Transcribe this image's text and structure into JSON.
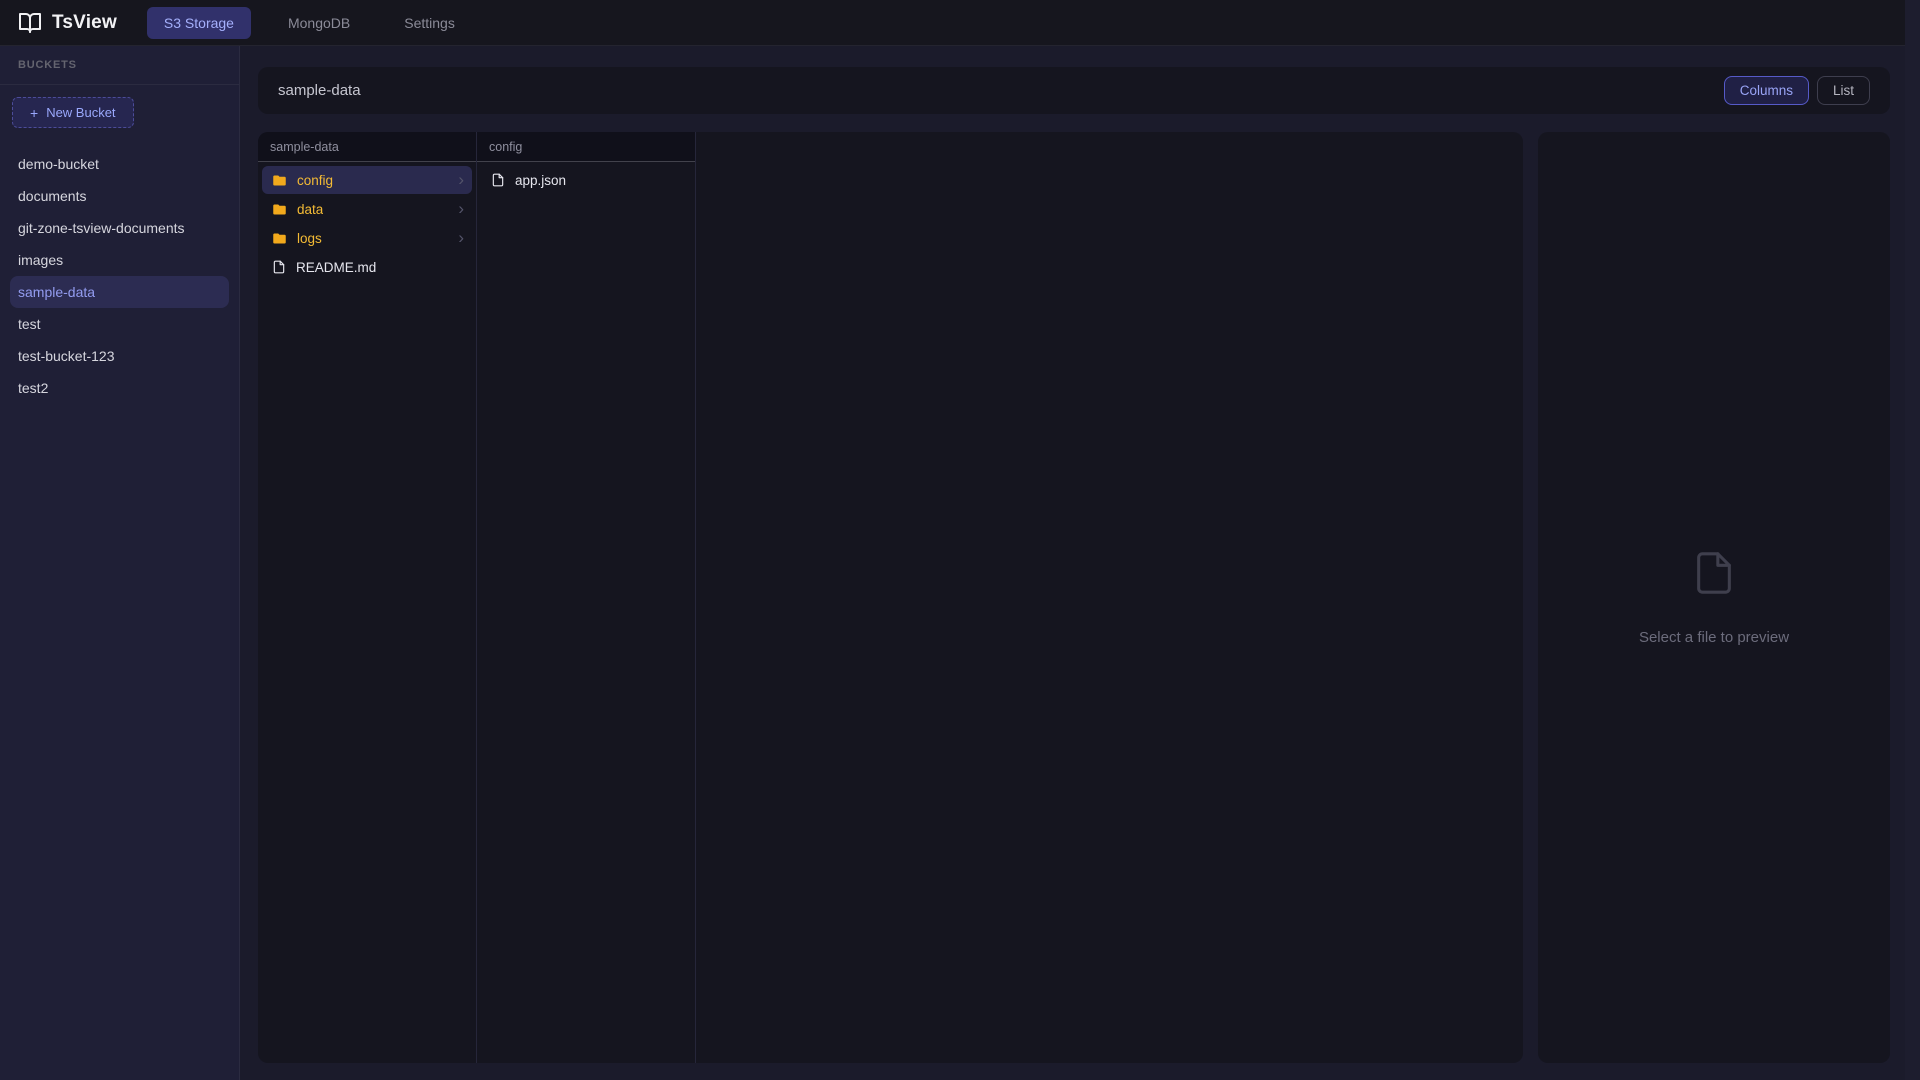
{
  "app": {
    "title": "TsView",
    "logo_icon": "book-open-icon"
  },
  "nav": {
    "tabs": [
      {
        "label": "S3 Storage",
        "active": true
      },
      {
        "label": "MongoDB",
        "active": false
      },
      {
        "label": "Settings",
        "active": false
      }
    ]
  },
  "sidebar": {
    "heading": "BUCKETS",
    "new_bucket_label": "New Bucket",
    "plus_glyph": "+",
    "buckets": [
      "demo-bucket",
      "documents",
      "git-zone-tsview-documents",
      "images",
      "sample-data",
      "test",
      "test-bucket-123",
      "test2"
    ],
    "selected_bucket": "sample-data"
  },
  "main": {
    "title": "sample-data",
    "view_buttons": [
      {
        "label": "Columns",
        "active": true
      },
      {
        "label": "List",
        "active": false
      }
    ]
  },
  "columns": [
    {
      "header": "sample-data",
      "items": [
        {
          "name": "config",
          "type": "folder",
          "selected": true,
          "has_chevron": true
        },
        {
          "name": "data",
          "type": "folder",
          "selected": false,
          "has_chevron": true
        },
        {
          "name": "logs",
          "type": "folder",
          "selected": false,
          "has_chevron": true
        },
        {
          "name": "README.md",
          "type": "file",
          "selected": false,
          "has_chevron": false
        }
      ]
    },
    {
      "header": "config",
      "items": [
        {
          "name": "app.json",
          "type": "file",
          "selected": false,
          "has_chevron": false
        }
      ]
    }
  ],
  "preview": {
    "placeholder": "Select a file to preview"
  },
  "icons": {
    "chevron_glyph": "›",
    "folder_icon": "folder-icon",
    "file_icon": "file-icon"
  },
  "colors": {
    "page_bg": "#1b1b2b",
    "header_bg": "#16161e",
    "sidebar_bg": "#1f1f36",
    "card_bg": "#15151f",
    "folder_amber": "#f3b02a",
    "selected_row_bg": "#2a2a4e",
    "selected_bucket_bg": "#2c2c52",
    "active_tab_bg": "#31316b",
    "accent_text": "#a5b0fc"
  }
}
